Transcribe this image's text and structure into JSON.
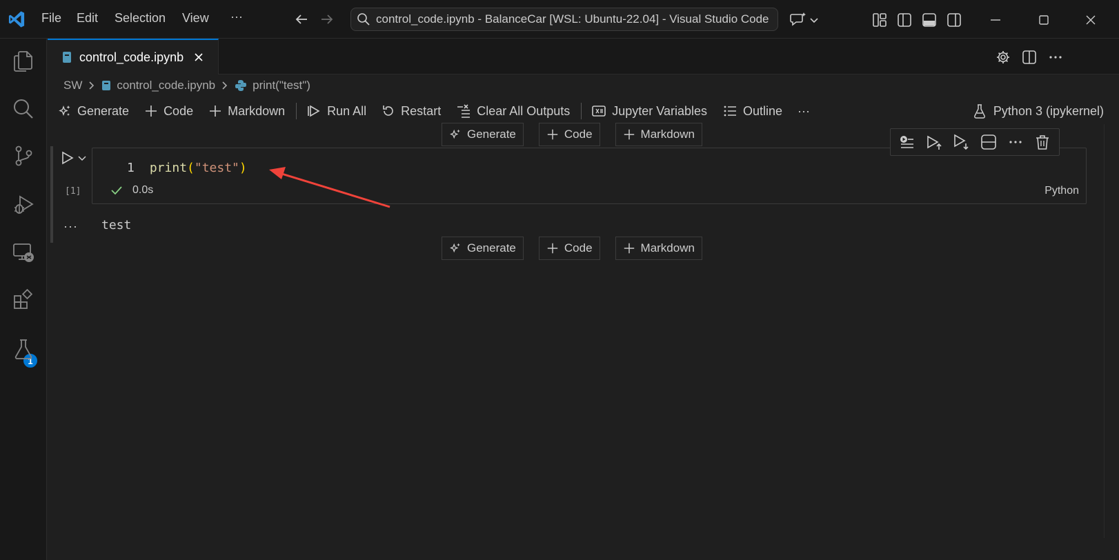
{
  "window": {
    "title": "control_code.ipynb - BalanceCar [WSL: Ubuntu-22.04] - Visual Studio Code",
    "menu": [
      "File",
      "Edit",
      "Selection",
      "View",
      "···"
    ]
  },
  "activity_bar": {
    "items": [
      "explorer-icon",
      "search-icon",
      "source-control-icon",
      "run-debug-icon",
      "remote-explorer-icon",
      "extensions-icon",
      "testing-icon"
    ],
    "extensions_badge": "1"
  },
  "editor": {
    "tab_label": "control_code.ipynb",
    "breadcrumb": [
      "SW",
      "control_code.ipynb",
      "print(\"test\")"
    ]
  },
  "notebook_toolbar": {
    "generate": "Generate",
    "code": "Code",
    "markdown": "Markdown",
    "run_all": "Run All",
    "restart": "Restart",
    "clear_all_outputs": "Clear All Outputs",
    "jupyter_variables": "Jupyter Variables",
    "outline": "Outline",
    "more": "···",
    "kernel": "Python 3 (ipykernel)"
  },
  "insert_toolbar": {
    "generate": "Generate",
    "code": "Code",
    "markdown": "Markdown"
  },
  "cell": {
    "line_number": "1",
    "code_fn": "print",
    "code_open": "(",
    "code_str": "\"test\"",
    "code_close": ")",
    "execution_count": "[1]",
    "duration": "0.0s",
    "language": "Python",
    "output_more": "···",
    "output": "test"
  },
  "colors": {
    "accent": "#0078d4",
    "success": "#89d185",
    "annotation_arrow": "#f0433a"
  }
}
